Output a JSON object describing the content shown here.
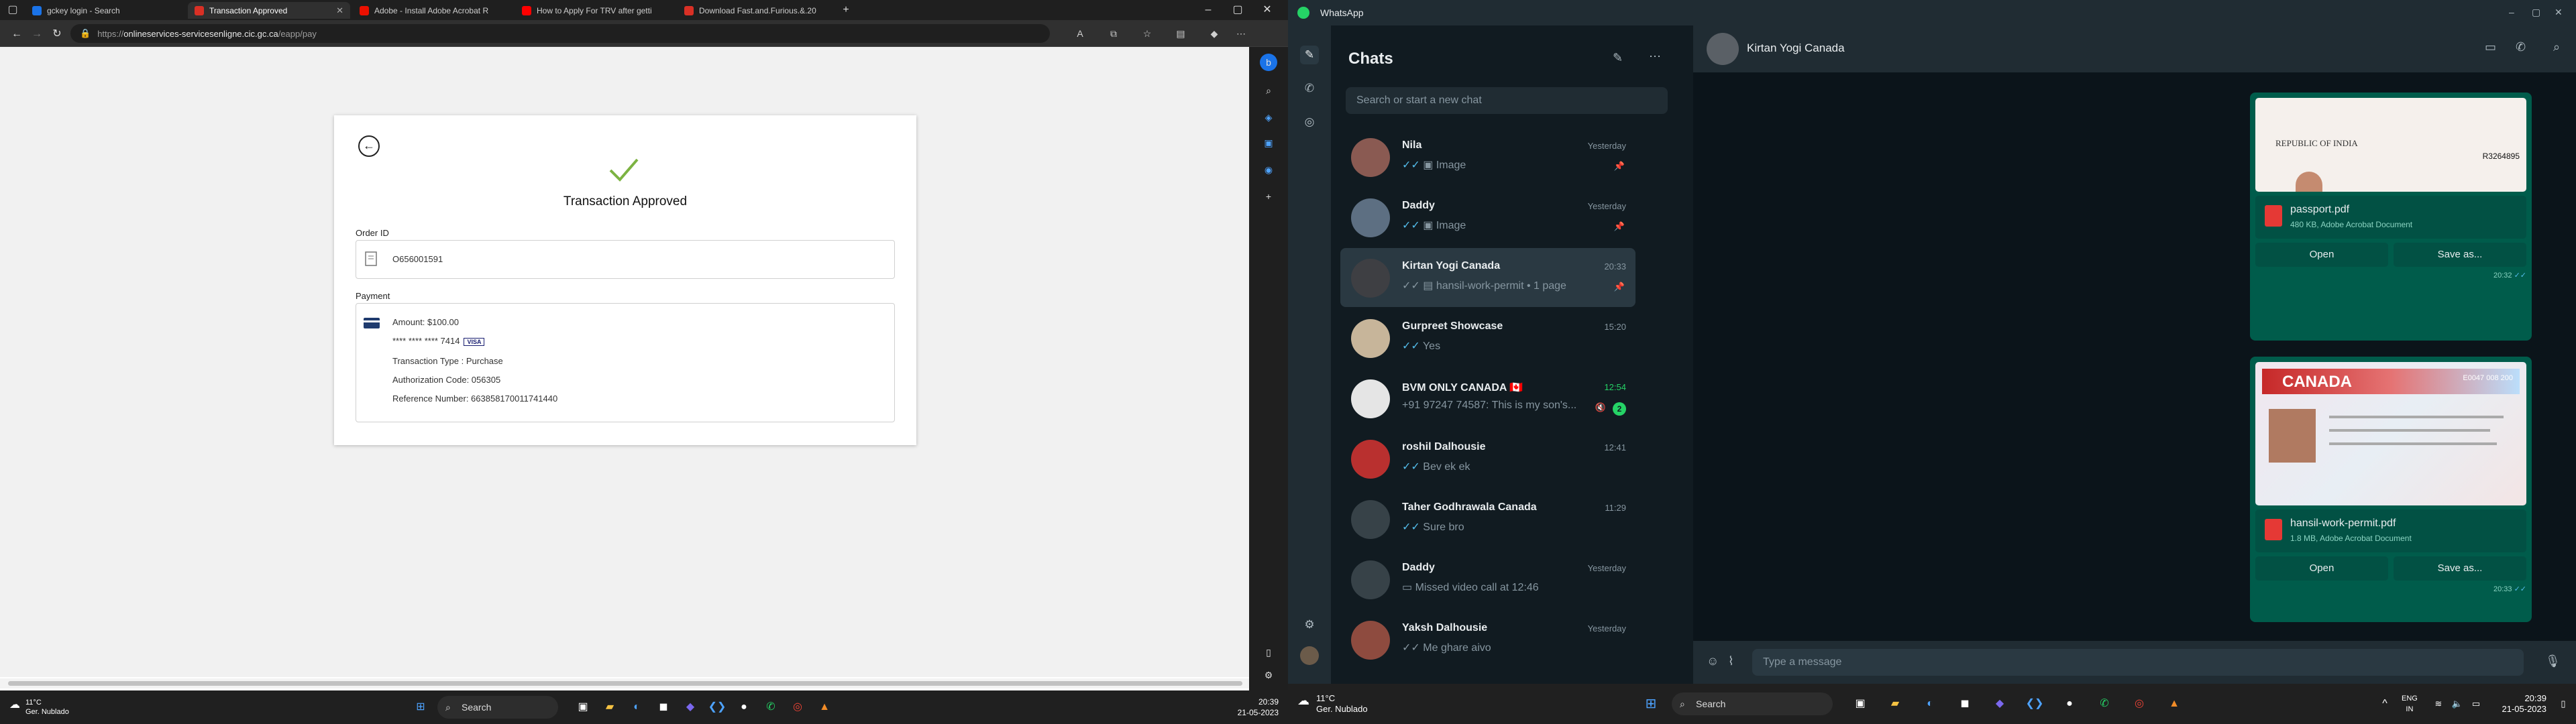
{
  "left_screen": {
    "browser": {
      "tabs": [
        {
          "label": "gckey login - Search",
          "color": "#1a73e8"
        },
        {
          "label": "Transaction Approved",
          "color": "#d93025"
        },
        {
          "label": "Adobe - Install Adobe Acrobat R",
          "color": "#eb1000"
        },
        {
          "label": "How to Apply For TRV after getti",
          "color": "#ff0000"
        },
        {
          "label": "Download Fast.and.Furious.&.20",
          "color": "#d93025"
        }
      ],
      "url_prefix": "https://",
      "url_host": "onlineservices-servicesenligne.cic.gc.ca",
      "url_path": "/eapp/pay"
    },
    "page": {
      "title": "Transaction Approved",
      "order_id_label": "Order ID",
      "order_id": "O656001591",
      "payment_label": "Payment",
      "amount": "Amount: $100.00",
      "card": "**** **** **** 7414",
      "card_brand": "VISA",
      "transaction_type": "Transaction Type : Purchase",
      "auth_code": "Authorization Code: 056305",
      "reference": "Reference Number: 663858170011741440"
    },
    "taskbar": {
      "weather_temp": "11°C",
      "weather_desc": "Ger. Nublado",
      "search": "Search",
      "time": "20:39",
      "date": "21-05-2023"
    }
  },
  "right_screen": {
    "app_title": "WhatsApp",
    "list_title": "Chats",
    "search_placeholder": "Search or start a new chat",
    "chats": [
      {
        "name": "Nila",
        "message": "Image",
        "time": "Yesterday",
        "pinned": true,
        "avatar": "#8a5a52"
      },
      {
        "name": "Daddy",
        "message": "Image",
        "time": "Yesterday",
        "pinned": true,
        "avatar": "#5d6f82"
      },
      {
        "name": "Kirtan Yogi Canada",
        "message": "hansil-work-permit • 1 page",
        "time": "20:33",
        "pinned": true,
        "avatar": "#3e3f43"
      },
      {
        "name": "Gurpreet Showcase",
        "message": "Yes",
        "time": "15:20",
        "pinned": false,
        "avatar": "#c7b59a"
      },
      {
        "name": "BVM ONLY CANADA 🇨🇦",
        "message": "+91 97247 74587: This is my son's...",
        "time": "12:54",
        "pinned": false,
        "unread": "2",
        "avatar": "#e5e5e5"
      },
      {
        "name": "roshil Dalhousie",
        "message": "Bev ek ek",
        "time": "12:41",
        "pinned": false,
        "avatar": "#b9302f"
      },
      {
        "name": "Taher Godhrawala Canada",
        "message": "Sure bro",
        "time": "11:29",
        "pinned": false,
        "avatar": "#374248"
      },
      {
        "name": "Daddy",
        "message": "Missed video call at 12:46",
        "time": "Yesterday",
        "pinned": false,
        "avatar": "#374248"
      },
      {
        "name": "Yaksh Dalhousie",
        "message": "Me ghare aivo",
        "time": "Yesterday",
        "pinned": false,
        "avatar": "#8e4b3f"
      }
    ],
    "conversation": {
      "contact": "Kirtan Yogi Canada",
      "documents": [
        {
          "name": "passport.pdf",
          "meta": "480 KB, Adobe Acrobat Document",
          "time": "20:32",
          "open": "Open",
          "save": "Save as...",
          "preview_text": "REPUBLIC OF INDIA",
          "preview_code": "R3264895"
        },
        {
          "name": "hansil-work-permit.pdf",
          "meta": "1.8 MB, Adobe Acrobat Document",
          "time": "20:33",
          "open": "Open",
          "save": "Save as...",
          "preview_text": "CANADA",
          "preview_code": "E0047 008 200"
        }
      ],
      "composer_placeholder": "Type a message"
    },
    "taskbar": {
      "weather_temp": "11°C",
      "weather_desc": "Ger. Nublado",
      "search": "Search",
      "lang1": "ENG",
      "lang2": "IN",
      "time": "20:39",
      "date": "21-05-2023"
    }
  },
  "accent_green": "#25d366",
  "approved_check_color": "#7cb342"
}
